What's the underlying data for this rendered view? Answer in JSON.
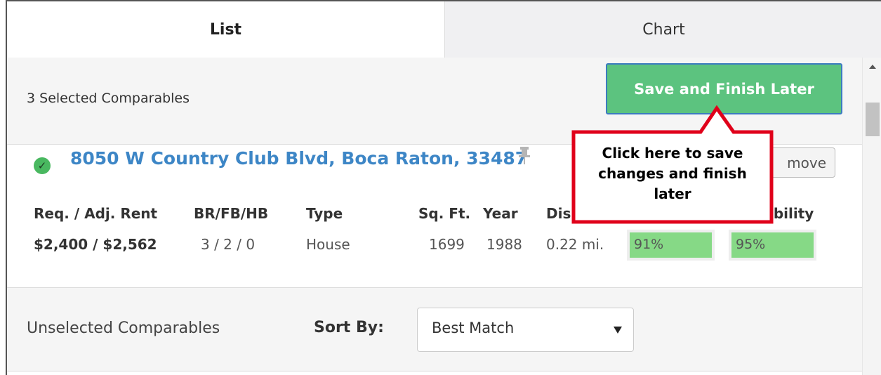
{
  "tabs": [
    {
      "label": "List",
      "active": true
    },
    {
      "label": "Chart",
      "active": false
    }
  ],
  "selected": {
    "title": "3 Selected Comparables",
    "save_button": "Save and Finish Later"
  },
  "comparable": {
    "status_icon": "check-circle-icon",
    "address": "8050 W Country Club Blvd, Boca Raton, 33487",
    "pin_icon": "pin-icon",
    "remove_label": "move",
    "headers": {
      "rent": "Req. / Adj. Rent",
      "beds": "BR/FB/HB",
      "type": "Type",
      "sqft": "Sq. Ft.",
      "year": "Year",
      "distance": "Dis",
      "score": "ibility"
    },
    "values": {
      "rent": "$2,400 / $2,562",
      "beds": "3 / 2 / 0",
      "type": "House",
      "sqft": "1699",
      "year": "1988",
      "distance": "0.22 mi.",
      "score1": "91%",
      "score2": "95%"
    }
  },
  "unselected": {
    "title": "Unselected Comparables",
    "sort_label": "Sort By:",
    "sort_value": "Best Match"
  },
  "callout": {
    "text": "Click here to save changes and finish later"
  },
  "colors": {
    "accent_link": "#3d86c6",
    "save_green": "#5cc37f",
    "score_green": "#86d986",
    "callout_red": "#e0001a"
  }
}
